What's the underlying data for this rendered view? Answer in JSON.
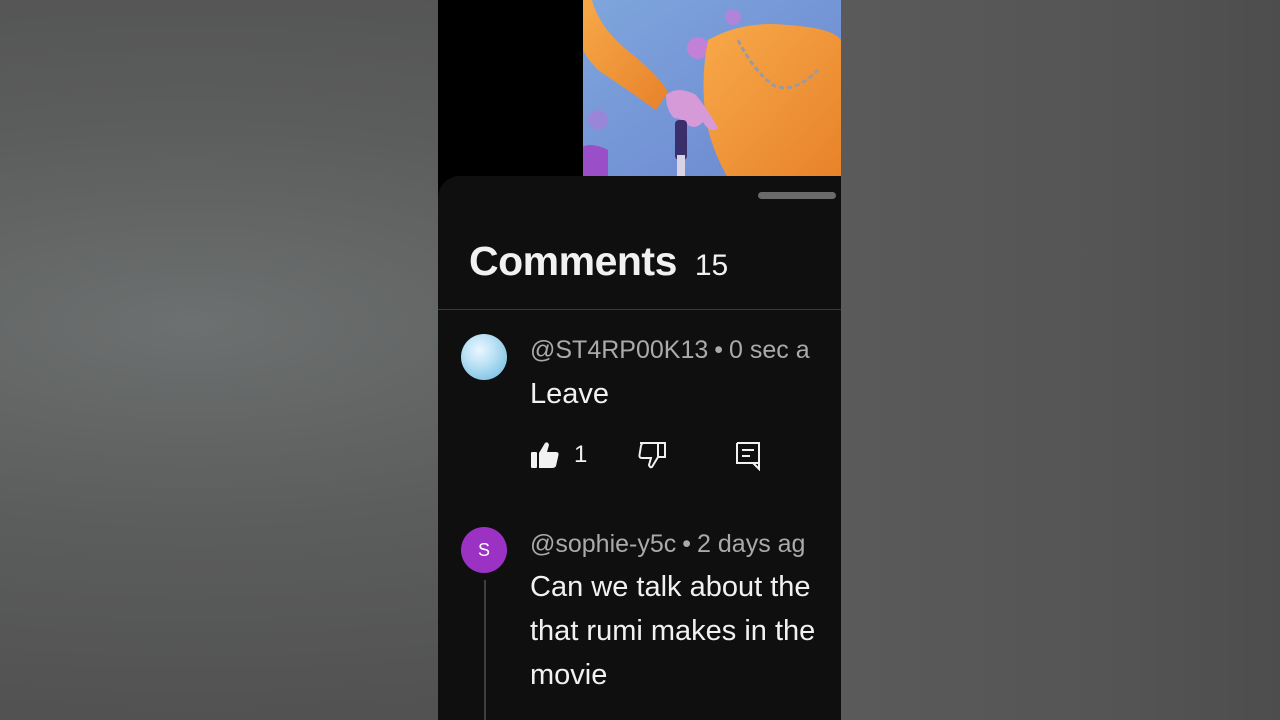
{
  "panel": {
    "title": "Comments",
    "count": "15"
  },
  "comments": [
    {
      "author": "@ST4RP00K13",
      "time": "0 sec a",
      "text": [
        "Leave"
      ],
      "likes": "1",
      "avatar": {
        "type": "image",
        "description": "sky-blue"
      }
    },
    {
      "author": "@sophie-y5c",
      "time": "2 days ag",
      "text": [
        "Can we talk about the",
        "that rumi makes in the",
        "movie"
      ],
      "avatar": {
        "type": "letter",
        "letter": "S",
        "color": "#9b32c4"
      }
    }
  ],
  "colors": {
    "panel_bg": "#0f0f0f",
    "text_primary": "#f1f1f1",
    "text_secondary": "#aaaaaa"
  }
}
